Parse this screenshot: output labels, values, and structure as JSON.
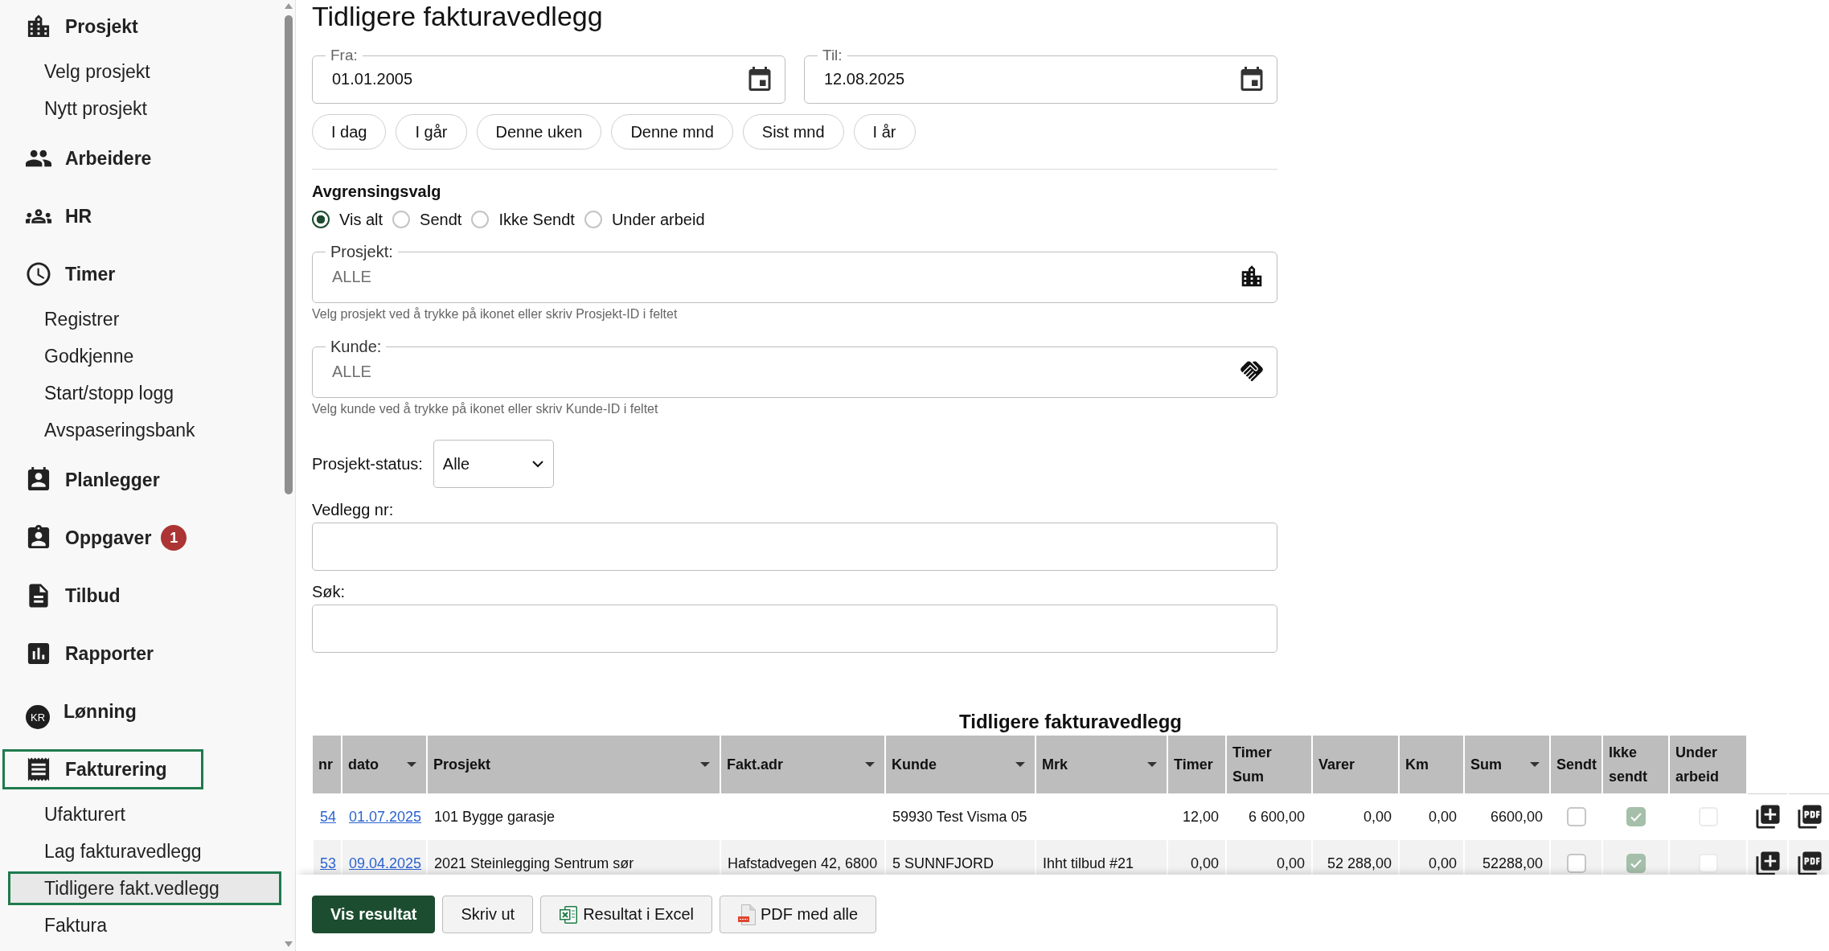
{
  "sidebar": {
    "sections": [
      {
        "label": "Prosjekt",
        "active": false,
        "children": [
          {
            "label": "Velg prosjekt",
            "selected": false
          },
          {
            "label": "Nytt prosjekt",
            "selected": false
          }
        ]
      },
      {
        "label": "Arbeidere",
        "active": false
      },
      {
        "label": "HR",
        "active": false
      },
      {
        "label": "Timer",
        "active": false,
        "children": [
          {
            "label": "Registrer",
            "selected": false
          },
          {
            "label": "Godkjenne",
            "selected": false
          },
          {
            "label": "Start/stopp logg",
            "selected": false
          },
          {
            "label": "Avspaseringsbank",
            "selected": false
          }
        ]
      },
      {
        "label": "Planlegger",
        "active": false
      },
      {
        "label": "Oppgaver",
        "active": false,
        "badge": "1"
      },
      {
        "label": "Tilbud",
        "active": false
      },
      {
        "label": "Rapporter",
        "active": false
      },
      {
        "label": "Lønning",
        "active": false,
        "icon_text": "KR"
      },
      {
        "label": "Fakturering",
        "active": true,
        "children": [
          {
            "label": "Ufakturert",
            "selected": false
          },
          {
            "label": "Lag fakturavedlegg",
            "selected": false
          },
          {
            "label": "Tidligere fakt.vedlegg",
            "selected": true
          },
          {
            "label": "Faktura",
            "selected": false
          }
        ]
      }
    ]
  },
  "page": {
    "title": "Tidligere fakturavedlegg"
  },
  "date_range": {
    "from": {
      "label": "Fra:",
      "value": "01.01.2005"
    },
    "to": {
      "label": "Til:",
      "value": "12.08.2025"
    },
    "presets": [
      "I dag",
      "I går",
      "Denne uken",
      "Denne mnd",
      "Sist mnd",
      "I år"
    ]
  },
  "filter": {
    "title": "Avgrensingsvalg",
    "options": [
      {
        "label": "Vis alt",
        "selected": true
      },
      {
        "label": "Sendt",
        "selected": false
      },
      {
        "label": "Ikke Sendt",
        "selected": false
      },
      {
        "label": "Under arbeid",
        "selected": false
      }
    ]
  },
  "project_field": {
    "label": "Prosjekt:",
    "placeholder": "ALLE",
    "hint": "Velg prosjekt ved å trykke på ikonet eller skriv Prosjekt-ID i feltet"
  },
  "customer_field": {
    "label": "Kunde:",
    "placeholder": "ALLE",
    "hint": "Velg kunde ved å trykke på ikonet eller skriv Kunde-ID i feltet"
  },
  "project_status": {
    "label": "Prosjekt-status:",
    "value": "Alle"
  },
  "attachment_number": {
    "label": "Vedlegg nr:"
  },
  "search": {
    "label": "Søk:"
  },
  "table": {
    "title": "Tidligere fakturavedlegg",
    "columns": [
      {
        "label": "nr",
        "dropdown": false
      },
      {
        "label": "dato",
        "dropdown": true
      },
      {
        "label": "Prosjekt",
        "dropdown": true
      },
      {
        "label": "Fakt.adr",
        "dropdown": true
      },
      {
        "label": "Kunde",
        "dropdown": true
      },
      {
        "label": "Mrk",
        "dropdown": true
      },
      {
        "label": "Timer",
        "dropdown": false
      },
      {
        "label": "Timer Sum",
        "dropdown": false
      },
      {
        "label": "Varer",
        "dropdown": false
      },
      {
        "label": "Km",
        "dropdown": false
      },
      {
        "label": "Sum",
        "dropdown": true
      },
      {
        "label": "Sendt",
        "dropdown": false
      },
      {
        "label": "Ikke sendt",
        "dropdown": false
      },
      {
        "label": "Under arbeid",
        "dropdown": false
      }
    ],
    "rows": [
      {
        "cells": [
          {
            "kind": "link",
            "text": "54"
          },
          {
            "kind": "link",
            "text": "01.07.2025"
          },
          {
            "kind": "text",
            "text": "101 Bygge garasje"
          },
          {
            "kind": "blank"
          },
          {
            "kind": "text",
            "text": "59930 Test Visma 05"
          },
          {
            "kind": "blank"
          },
          {
            "kind": "number",
            "text": "12,00"
          },
          {
            "kind": "number",
            "text": "6 600,00"
          },
          {
            "kind": "number",
            "text": "0,00"
          },
          {
            "kind": "number",
            "text": "0,00"
          },
          {
            "kind": "number",
            "text": "6600,00"
          },
          {
            "kind": "check",
            "checked": false,
            "disabled": false
          },
          {
            "kind": "check",
            "checked": true,
            "disabled": true
          },
          {
            "kind": "check",
            "checked": false,
            "disabled": true
          }
        ]
      },
      {
        "cells": [
          {
            "kind": "link",
            "text": "53"
          },
          {
            "kind": "link",
            "text": "09.04.2025"
          },
          {
            "kind": "text",
            "text": "2021 Steinlegging Sentrum sør"
          },
          {
            "kind": "text",
            "text": "Hafstadvegen 42, 6800"
          },
          {
            "kind": "text",
            "text": "5 SUNNFJORD"
          },
          {
            "kind": "text",
            "text": "Ihht tilbud #21"
          },
          {
            "kind": "number",
            "text": "0,00"
          },
          {
            "kind": "number",
            "text": "0,00"
          },
          {
            "kind": "number",
            "text": "52 288,00"
          },
          {
            "kind": "number",
            "text": "0,00"
          },
          {
            "kind": "number",
            "text": "52288,00"
          },
          {
            "kind": "check",
            "checked": false,
            "disabled": false
          },
          {
            "kind": "check",
            "checked": true,
            "disabled": true
          },
          {
            "kind": "check",
            "checked": false,
            "disabled": true
          }
        ]
      }
    ]
  },
  "actions": [
    {
      "label": "Vis resultat",
      "kind": "primary"
    },
    {
      "label": "Skriv ut",
      "kind": "plain"
    },
    {
      "label": "Resultat i Excel",
      "kind": "excel"
    },
    {
      "label": "PDF med alle",
      "kind": "pdf"
    }
  ]
}
